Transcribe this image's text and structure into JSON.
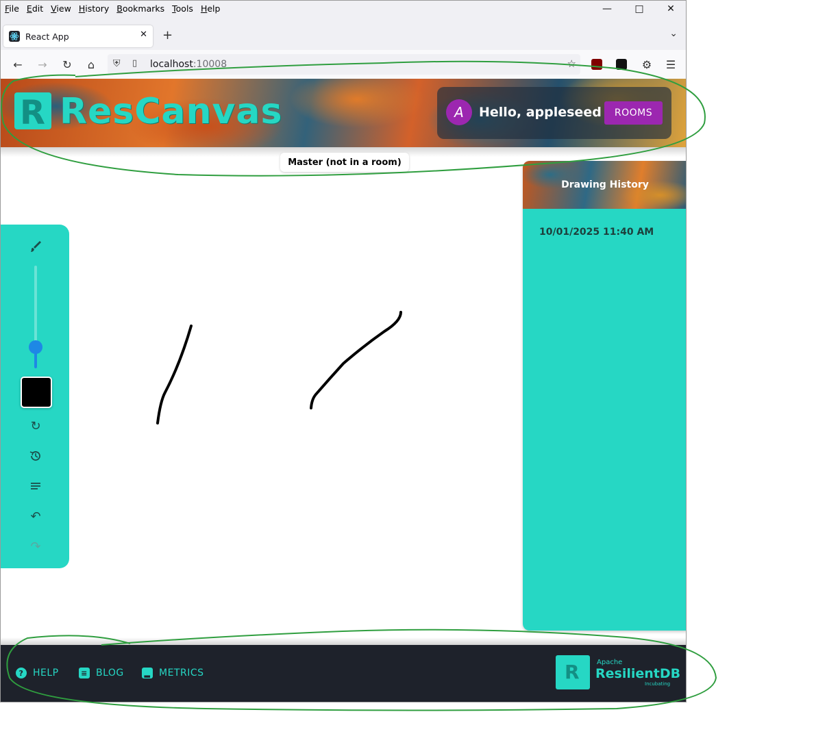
{
  "browser": {
    "menu": [
      "File",
      "Edit",
      "View",
      "History",
      "Bookmarks",
      "Tools",
      "Help"
    ],
    "tab_title": "React App",
    "url_host": "localhost",
    "url_port": ":10008"
  },
  "header": {
    "logo_text": "ResCanvas",
    "avatar_letter": "A",
    "greeting": "Hello, appleseed",
    "rooms_button": "ROOMS"
  },
  "room_label": "Master (not in a room)",
  "toolbar": {
    "icons": [
      "brush-icon",
      "refresh-icon",
      "history-icon",
      "clear-icon",
      "undo-icon",
      "redo-icon"
    ],
    "brush_color": "#000000",
    "brush_size_fraction": 0.2
  },
  "history": {
    "title": "Drawing History",
    "entries": [
      "10/01/2025 11:40 AM"
    ]
  },
  "footer": {
    "links": [
      "HELP",
      "BLOG",
      "METRICS"
    ],
    "brand_apache": "Apache",
    "brand_name": "ResilientDB",
    "brand_incubating": "Incubating"
  },
  "colors": {
    "accent": "#26d7c4",
    "purple": "#9c27b0",
    "footer_bg": "#1e222b"
  }
}
